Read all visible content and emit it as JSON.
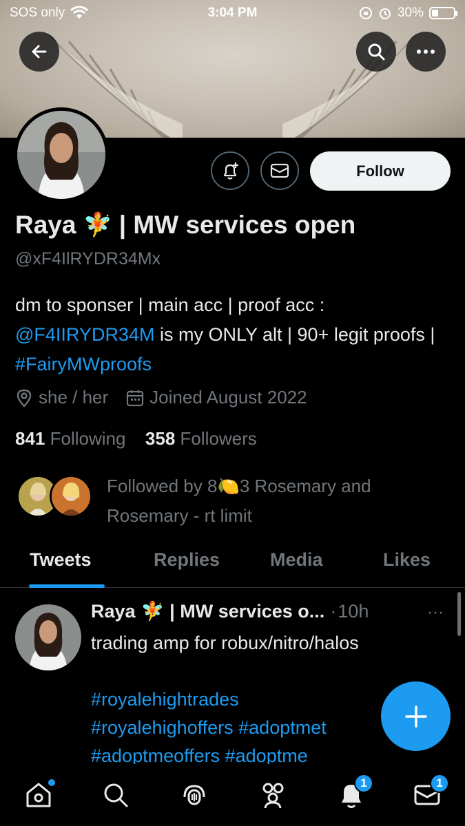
{
  "status_bar": {
    "carrier": "SOS only",
    "time": "3:04 PM",
    "battery": "30%",
    "battery_level": 0.3
  },
  "profile": {
    "display_name": "Raya",
    "name_emoji": "🧚",
    "name_suffix": "| MW services open",
    "handle": "@xF4IlRYDR34Mx",
    "follow_label": "Follow",
    "bio": {
      "line1": "dm to sponser | main acc | proof acc :",
      "mention": "@F4IIRYDR34M",
      "middle": " is my ONLY alt | 90+ legit proofs | ",
      "hashtag": "#FairyMWproofs"
    },
    "pronouns": "she / her",
    "joined": "Joined August 2022",
    "following_count": "841",
    "following_label": "Following",
    "followers_count": "358",
    "followers_label": "Followers",
    "followed_by": {
      "prefix": "Followed by",
      "name1_start": "8",
      "name1_emoji": "🍋",
      "name1_end": "3 Rosemary and",
      "name2": "Rosemary - rt limit"
    }
  },
  "tabs": [
    {
      "label": "Tweets",
      "active": true
    },
    {
      "label": "Replies",
      "active": false
    },
    {
      "label": "Media",
      "active": false
    },
    {
      "label": "Likes",
      "active": false
    }
  ],
  "tweet": {
    "name": "Raya",
    "emoji": "🧚",
    "name_rest": "| MW services o...",
    "separator": "·",
    "time": "10h",
    "more": "···",
    "line1": "trading amp for robux/nitro/halos",
    "hashtags_line1": "#royalehightrades",
    "hashtags_line2": "#royalehighoffers #adoptmet",
    "hashtags_line3": "#adoptmeoffers #adoptme"
  },
  "bottom_nav": {
    "notifications_badge": "1",
    "messages_badge": "1"
  },
  "colors": {
    "accent": "#1d9bf0",
    "background": "#000000",
    "text": "#e7e9ea",
    "muted": "#71767b"
  }
}
